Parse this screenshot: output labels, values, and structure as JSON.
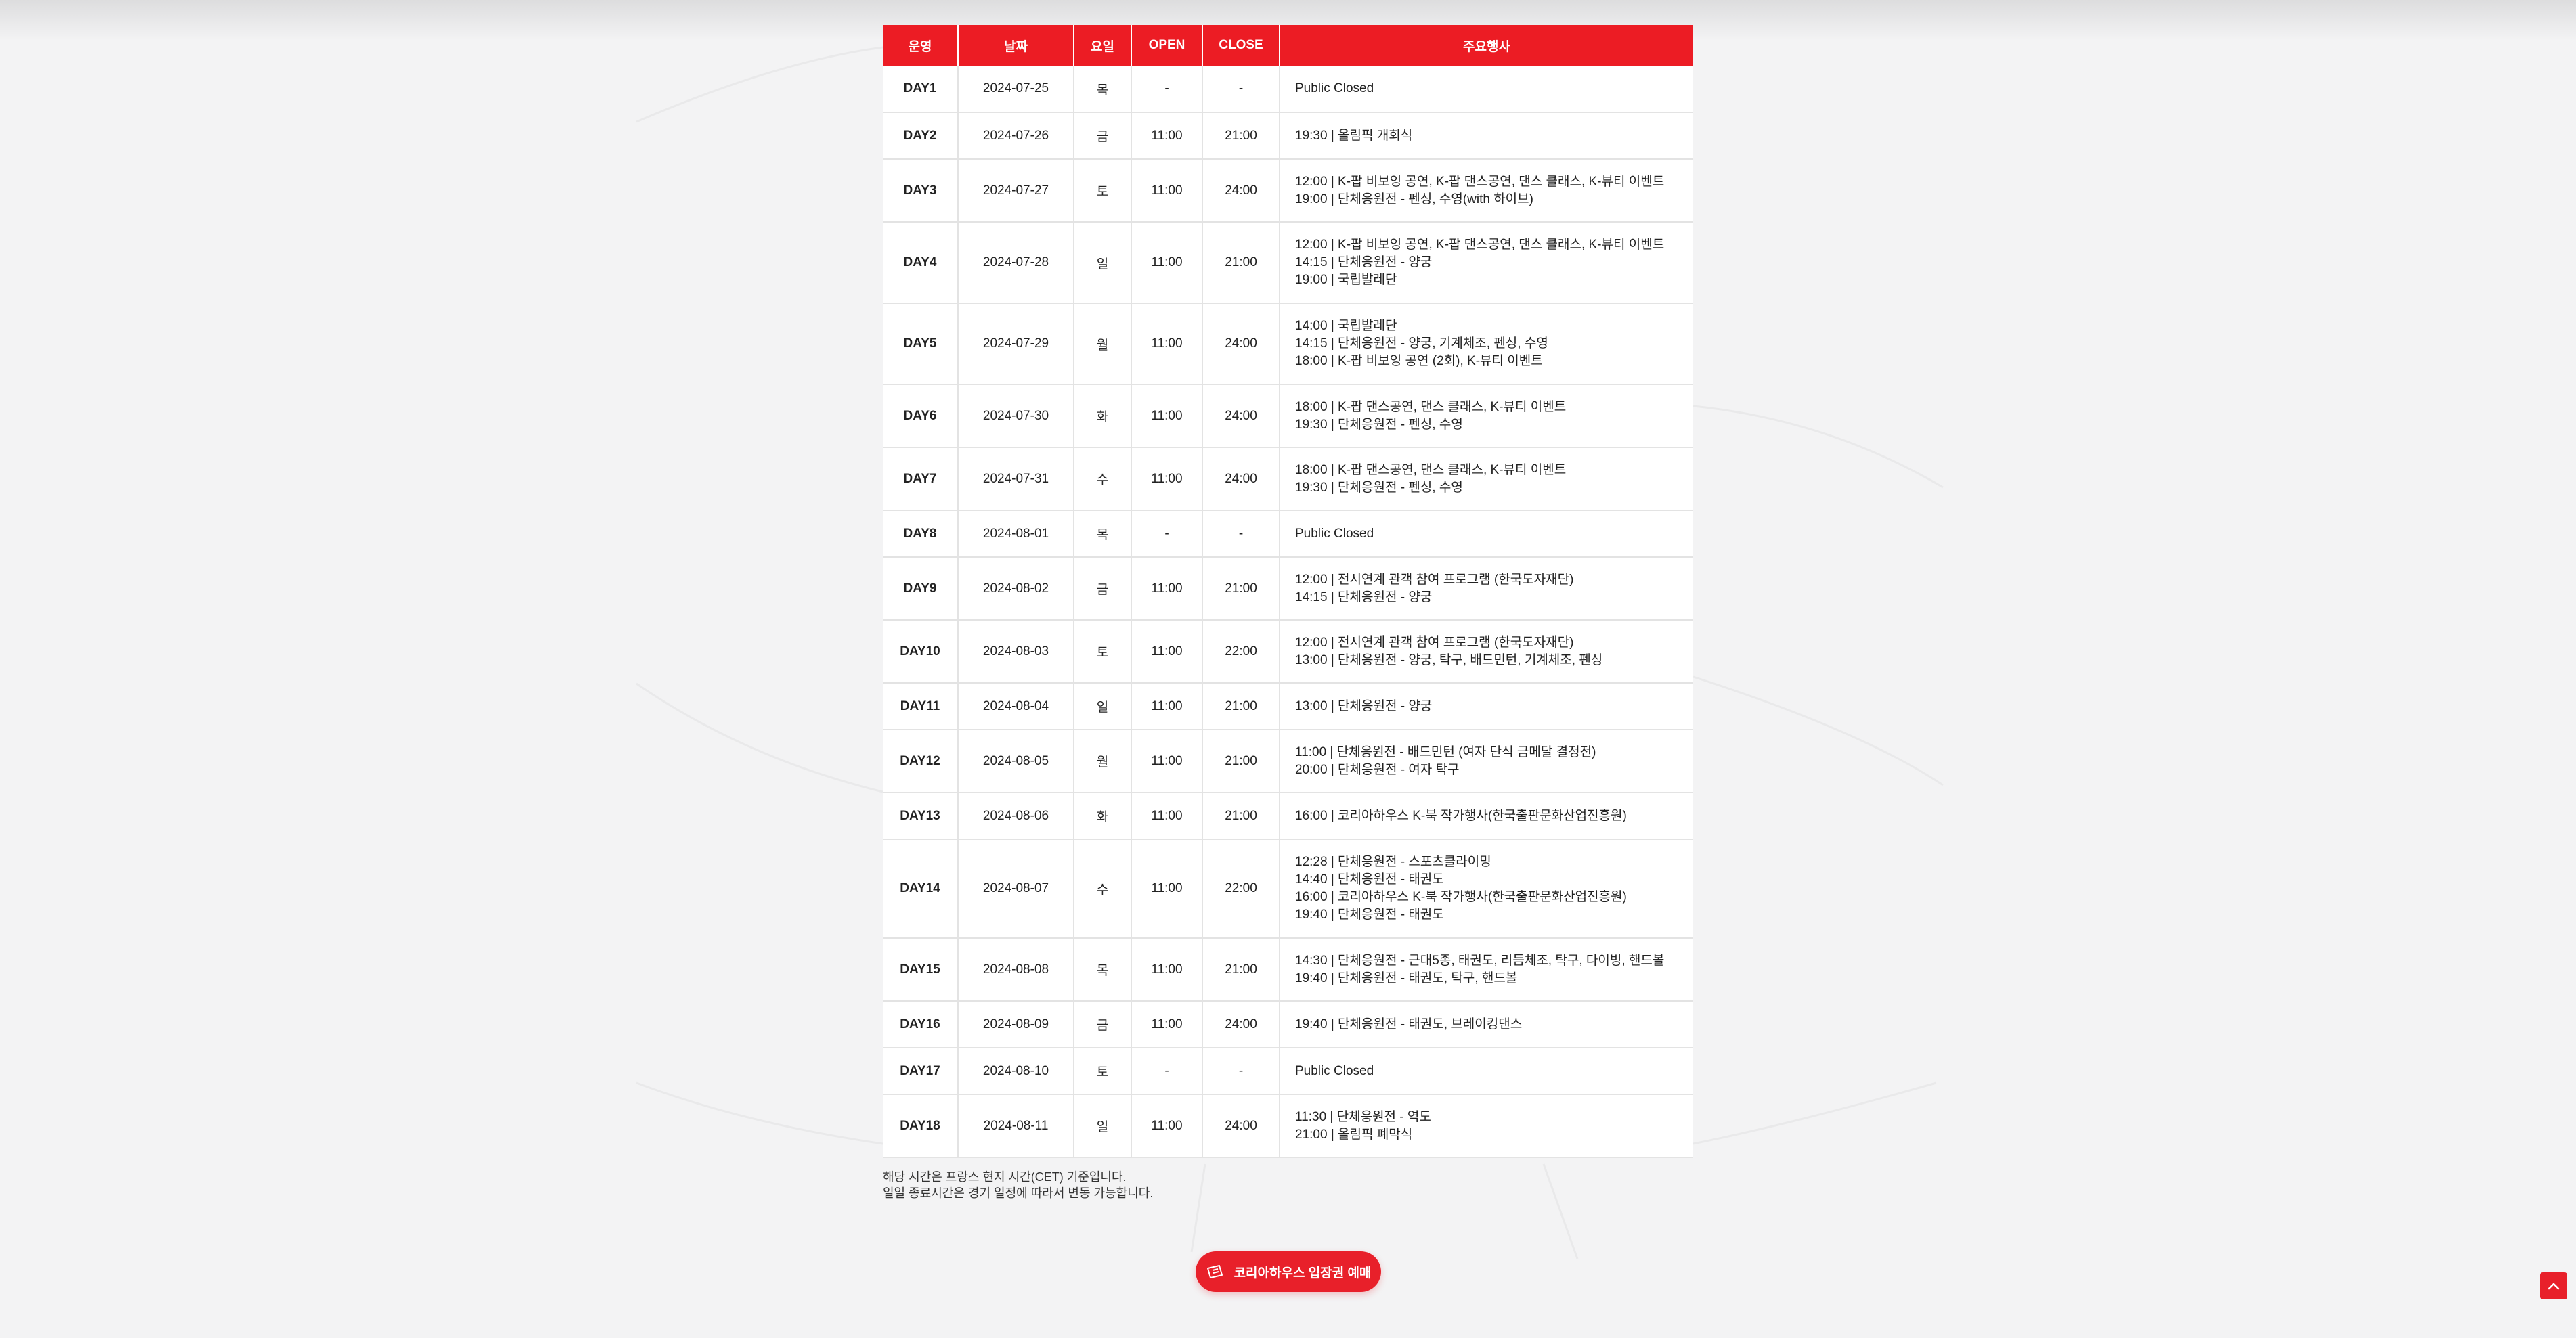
{
  "table": {
    "headers": {
      "day": "운영",
      "date": "날짜",
      "weekday": "요일",
      "open": "OPEN",
      "close": "CLOSE",
      "events": "주요행사"
    },
    "rows": [
      {
        "day": "DAY1",
        "date": "2024-07-25",
        "weekday": "목",
        "open": "-",
        "close": "-",
        "events": [
          "Public Closed"
        ]
      },
      {
        "day": "DAY2",
        "date": "2024-07-26",
        "weekday": "금",
        "open": "11:00",
        "close": "21:00",
        "events": [
          "19:30 | 올림픽 개회식"
        ]
      },
      {
        "day": "DAY3",
        "date": "2024-07-27",
        "weekday": "토",
        "open": "11:00",
        "close": "24:00",
        "events": [
          "12:00 | K-팝 비보잉 공연, K-팝 댄스공연, 댄스 클래스, K-뷰티 이벤트",
          "19:00 | 단체응원전 - 펜싱, 수영(with 하이브)"
        ]
      },
      {
        "day": "DAY4",
        "date": "2024-07-28",
        "weekday": "일",
        "open": "11:00",
        "close": "21:00",
        "events": [
          "12:00 | K-팝 비보잉 공연, K-팝 댄스공연, 댄스 클래스, K-뷰티 이벤트",
          "14:15 | 단체응원전 - 양궁",
          "19:00 | 국립발레단"
        ]
      },
      {
        "day": "DAY5",
        "date": "2024-07-29",
        "weekday": "월",
        "open": "11:00",
        "close": "24:00",
        "events": [
          "14:00 | 국립발레단",
          "14:15 | 단체응원전 - 양궁, 기계체조, 펜싱, 수영",
          "18:00 | K-팝 비보잉 공연 (2회), K-뷰티 이벤트"
        ]
      },
      {
        "day": "DAY6",
        "date": "2024-07-30",
        "weekday": "화",
        "open": "11:00",
        "close": "24:00",
        "events": [
          "18:00 | K-팝 댄스공연, 댄스 클래스, K-뷰티 이벤트",
          "19:30 | 단체응원전 - 펜싱, 수영"
        ]
      },
      {
        "day": "DAY7",
        "date": "2024-07-31",
        "weekday": "수",
        "open": "11:00",
        "close": "24:00",
        "events": [
          "18:00 | K-팝 댄스공연, 댄스 클래스, K-뷰티 이벤트",
          "19:30 | 단체응원전 - 펜싱, 수영"
        ]
      },
      {
        "day": "DAY8",
        "date": "2024-08-01",
        "weekday": "목",
        "open": "-",
        "close": "-",
        "events": [
          "Public Closed"
        ]
      },
      {
        "day": "DAY9",
        "date": "2024-08-02",
        "weekday": "금",
        "open": "11:00",
        "close": "21:00",
        "events": [
          "12:00 | 전시연계 관객 참여 프로그램 (한국도자재단)",
          "14:15 | 단체응원전 - 양궁"
        ]
      },
      {
        "day": "DAY10",
        "date": "2024-08-03",
        "weekday": "토",
        "open": "11:00",
        "close": "22:00",
        "events": [
          "12:00 | 전시연계 관객 참여 프로그램 (한국도자재단)",
          "13:00 | 단체응원전 - 양궁, 탁구, 배드민턴, 기계체조, 펜싱"
        ]
      },
      {
        "day": "DAY11",
        "date": "2024-08-04",
        "weekday": "일",
        "open": "11:00",
        "close": "21:00",
        "events": [
          "13:00 | 단체응원전 - 양궁"
        ]
      },
      {
        "day": "DAY12",
        "date": "2024-08-05",
        "weekday": "월",
        "open": "11:00",
        "close": "21:00",
        "events": [
          "11:00  |  단체응원전 - 배드민턴 (여자 단식 금메달 결정전)",
          "20:00  |  단체응원전 - 여자 탁구"
        ]
      },
      {
        "day": "DAY13",
        "date": "2024-08-06",
        "weekday": "화",
        "open": "11:00",
        "close": "21:00",
        "events": [
          "16:00 | 코리아하우스 K-북 작가행사(한국출판문화산업진흥원)"
        ]
      },
      {
        "day": "DAY14",
        "date": "2024-08-07",
        "weekday": "수",
        "open": "11:00",
        "close": "22:00",
        "events": [
          "12:28 | 단체응원전 - 스포츠클라이밍",
          "14:40 | 단체응원전 - 태권도",
          "16:00 | 코리아하우스 K-북 작가행사(한국출판문화산업진흥원)",
          "19:40 | 단체응원전 - 태권도"
        ]
      },
      {
        "day": "DAY15",
        "date": "2024-08-08",
        "weekday": "목",
        "open": "11:00",
        "close": "21:00",
        "events": [
          "14:30 | 단체응원전 - 근대5종, 태권도, 리듬체조, 탁구, 다이빙, 핸드볼",
          "19:40 | 단체응원전 - 태권도, 탁구, 핸드볼"
        ]
      },
      {
        "day": "DAY16",
        "date": "2024-08-09",
        "weekday": "금",
        "open": "11:00",
        "close": "24:00",
        "events": [
          "19:40 | 단체응원전 - 태권도, 브레이킹댄스"
        ]
      },
      {
        "day": "DAY17",
        "date": "2024-08-10",
        "weekday": "토",
        "open": "-",
        "close": "-",
        "events": [
          "Public Closed"
        ]
      },
      {
        "day": "DAY18",
        "date": "2024-08-11",
        "weekday": "일",
        "open": "11:00",
        "close": "24:00",
        "events": [
          "11:30 | 단체응원전 - 역도",
          "21:00 | 올림픽 폐막식"
        ]
      }
    ]
  },
  "notes": [
    "해당 시간은 프랑스 현지 시간(CET) 기준입니다.",
    "일일 종료시간은 경기 일정에 따라서 변동 가능합니다."
  ],
  "ticket_button": {
    "label": "코리아하우스 입장권 예매",
    "icon": "ticket-icon"
  },
  "scroll_top": {
    "icon": "chevron-up-icon"
  },
  "colors": {
    "accent": "#ec1c24",
    "saturday": "#1f48d6",
    "sunday": "#e8202a",
    "background": "#f3f3f4"
  }
}
